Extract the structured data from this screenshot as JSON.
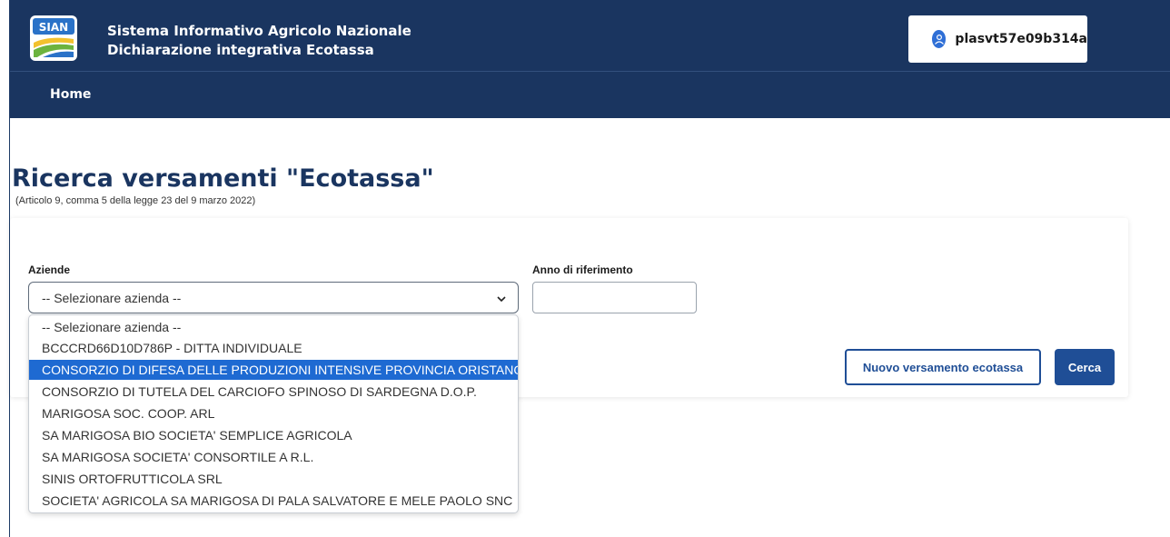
{
  "header": {
    "logo_text": "SIAN",
    "app_title": "Sistema Informativo Agricolo Nazionale",
    "app_subtitle": "Dichiarazione integrativa Ecotassa",
    "user": "plasvt57e09b314a"
  },
  "nav": {
    "home": "Home"
  },
  "page": {
    "title": "Ricerca versamenti \"Ecotassa\"",
    "subtitle": "(Articolo 9, comma 5 della legge 23 del 9 marzo 2022)"
  },
  "form": {
    "aziende_label": "Aziende",
    "aziende_selected": "-- Selezionare azienda --",
    "anno_label": "Anno di riferimento",
    "anno_value": "",
    "nuovo_button": "Nuovo versamento ecotassa",
    "cerca_button": "Cerca"
  },
  "dropdown": {
    "highlighted_index": 2,
    "options": [
      "-- Selezionare azienda --",
      "BCCCRD66D10D786P - DITTA INDIVIDUALE",
      "CONSORZIO DI DIFESA DELLE PRODUZIONI INTENSIVE PROVINCIA ORISTANO",
      "CONSORZIO DI TUTELA DEL CARCIOFO SPINOSO DI SARDEGNA D.O.P.",
      "MARIGOSA SOC. COOP. ARL",
      "SA MARIGOSA BIO SOCIETA' SEMPLICE AGRICOLA",
      "SA MARIGOSA SOCIETA' CONSORTILE A R.L.",
      "SINIS ORTOFRUTTICOLA SRL",
      "SOCIETA' AGRICOLA SA MARIGOSA DI PALA SALVATORE E MELE PAOLO SNC"
    ]
  },
  "colors": {
    "header_bg": "#1a3560",
    "primary": "#1f4e96",
    "highlight": "#1e6ad2"
  },
  "icons": [
    "sian-logo",
    "user-icon",
    "chevron-down-icon"
  ]
}
